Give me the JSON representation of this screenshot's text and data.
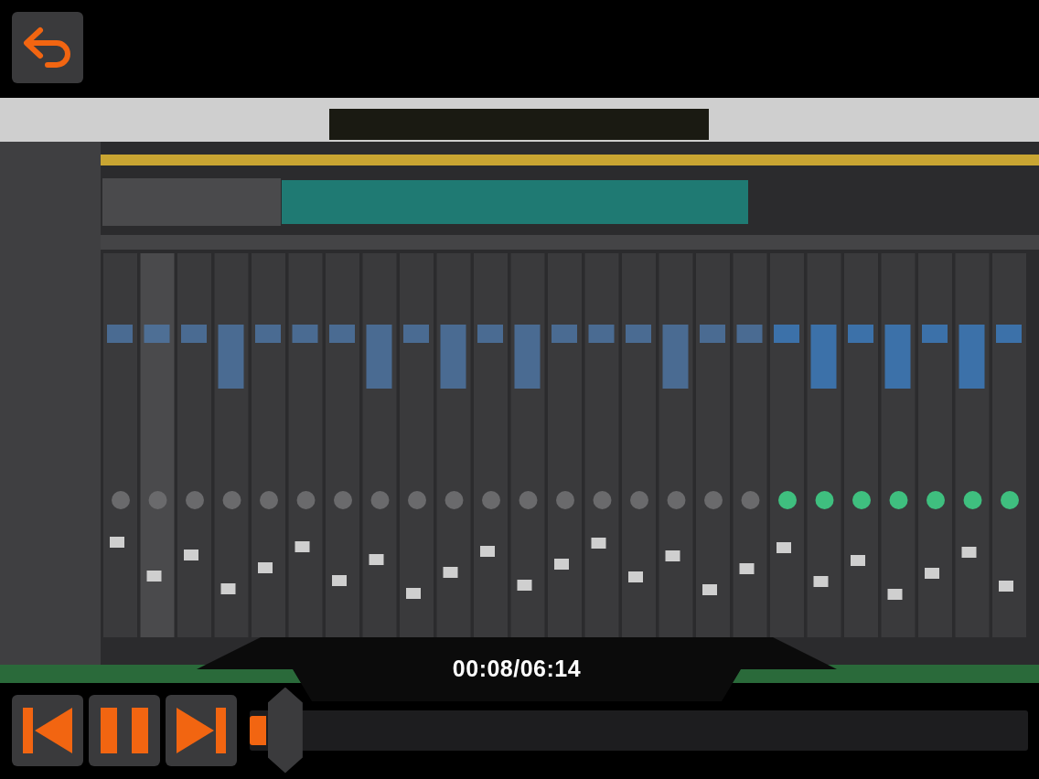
{
  "player": {
    "time": "00:08/06:14",
    "playing": true,
    "progress": {
      "level": 0.021
    }
  }
}
